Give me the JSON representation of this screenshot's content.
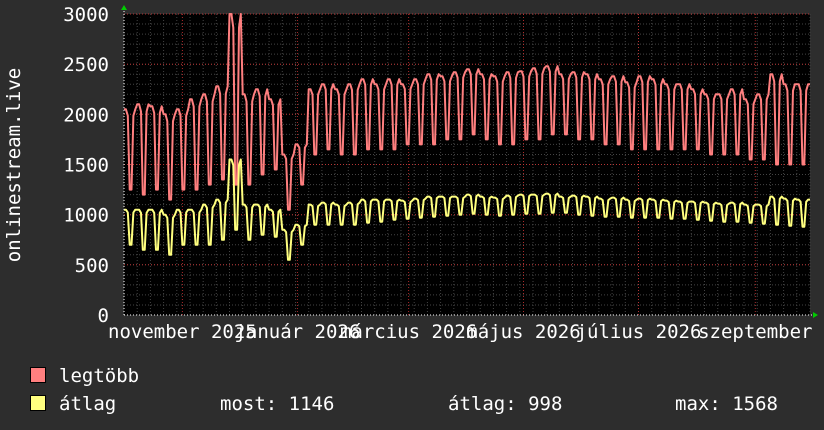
{
  "chart_data": {
    "type": "line",
    "title": "",
    "ylabel": "onlinestream.live",
    "xlabel": "",
    "ylim": [
      0,
      3000
    ],
    "yticks": [
      0,
      500,
      1000,
      1500,
      2000,
      2500,
      3000
    ],
    "xlim": [
      "2025-10-01",
      "2026-09-30"
    ],
    "xticks": [
      {
        "label": "november 2025",
        "date": "2025-11-01"
      },
      {
        "label": "január 2026",
        "date": "2026-01-01"
      },
      {
        "label": "március 2026",
        "date": "2026-03-01"
      },
      {
        "label": "május 2026",
        "date": "2026-05-01"
      },
      {
        "label": "július 2026",
        "date": "2026-07-01"
      },
      {
        "label": "szeptember",
        "date": "2026-09-01"
      }
    ],
    "grid": true,
    "legend_position": "bottom",
    "series": [
      {
        "name": "legtöbb",
        "color": "#ff7f7f",
        "weekly_low": [
          1250,
          1200,
          1250,
          1150,
          1250,
          1250,
          1300,
          1350,
          1300,
          1300,
          1400,
          1450,
          1050,
          1300,
          1600,
          1650,
          1600,
          1600,
          1650,
          1650,
          1650,
          1700,
          1700,
          1700,
          1750,
          1750,
          1800,
          1750,
          1700,
          1700,
          1750,
          1750,
          1800,
          1800,
          1750,
          1750,
          1700,
          1700,
          1650,
          1650,
          1650,
          1650,
          1650,
          1650,
          1600,
          1600,
          1600,
          1550,
          1550,
          1500,
          1500,
          1500
        ],
        "weekly_high": [
          2050,
          2100,
          2080,
          2000,
          2050,
          2150,
          2200,
          2280,
          3000,
          2200,
          2250,
          2150,
          1600,
          1700,
          2250,
          2300,
          2250,
          2300,
          2350,
          2300,
          2350,
          2300,
          2350,
          2400,
          2380,
          2420,
          2450,
          2400,
          2380,
          2420,
          2430,
          2460,
          2480,
          2400,
          2420,
          2400,
          2350,
          2380,
          2320,
          2380,
          2350,
          2300,
          2300,
          2250,
          2200,
          2200,
          2250,
          2150,
          2200,
          2400,
          2300,
          2300
        ]
      },
      {
        "name": "átlag",
        "color": "#ffff7f",
        "weekly_low": [
          700,
          650,
          650,
          600,
          700,
          700,
          700,
          750,
          850,
          750,
          800,
          780,
          550,
          700,
          900,
          900,
          900,
          900,
          920,
          930,
          950,
          960,
          970,
          980,
          990,
          1000,
          1010,
          1000,
          990,
          1000,
          1010,
          1010,
          1020,
          1020,
          1000,
          990,
          980,
          980,
          970,
          970,
          970,
          960,
          960,
          950,
          940,
          930,
          930,
          920,
          910,
          900,
          890,
          880
        ],
        "weekly_high": [
          1050,
          1050,
          1050,
          1000,
          1050,
          1050,
          1100,
          1150,
          1550,
          1100,
          1100,
          1050,
          850,
          900,
          1100,
          1120,
          1100,
          1120,
          1150,
          1150,
          1150,
          1140,
          1160,
          1180,
          1180,
          1180,
          1200,
          1180,
          1170,
          1190,
          1200,
          1200,
          1210,
          1180,
          1190,
          1180,
          1160,
          1170,
          1150,
          1160,
          1150,
          1140,
          1130,
          1130,
          1120,
          1110,
          1120,
          1100,
          1100,
          1180,
          1160,
          1150
        ]
      }
    ]
  },
  "legend": {
    "items": [
      {
        "name": "legtöbb",
        "color": "#ff7f7f"
      },
      {
        "name": "átlag",
        "color": "#ffff7f"
      }
    ],
    "stats": {
      "now": "most: 1146",
      "avg": "átlag: 998",
      "max": "max: 1568"
    }
  }
}
